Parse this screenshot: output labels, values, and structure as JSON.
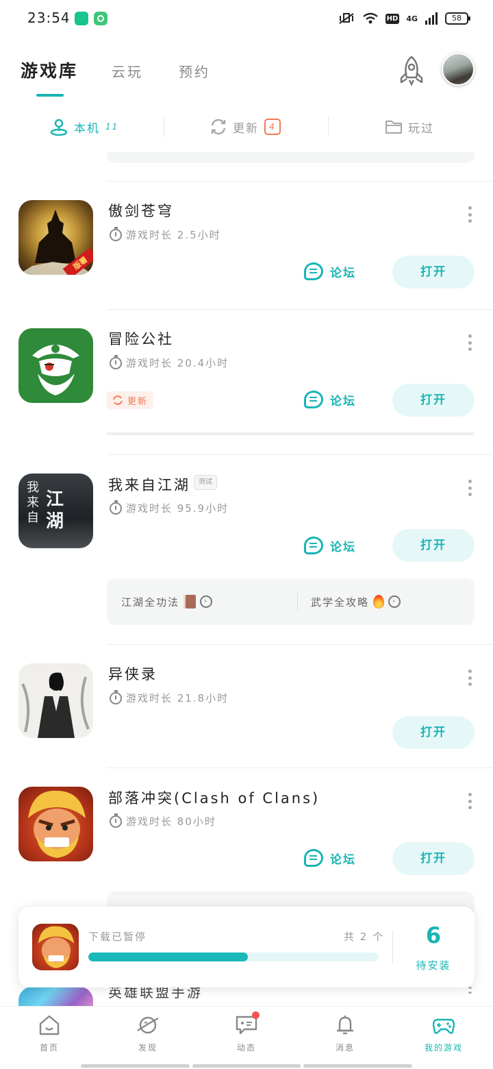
{
  "status_bar": {
    "time": "23:54",
    "network": "4G",
    "hd": "HD",
    "battery": "58"
  },
  "header": {
    "tabs": [
      {
        "label": "游戏库",
        "active": true
      },
      {
        "label": "云玩",
        "active": false
      },
      {
        "label": "预约",
        "active": false
      }
    ]
  },
  "subtabs": [
    {
      "label": "本机",
      "count": "11",
      "active": true
    },
    {
      "label": "更新",
      "badge": "4",
      "active": false
    },
    {
      "label": "玩过",
      "active": false
    }
  ],
  "games": [
    {
      "name": "傲剑苍穹",
      "playtime": "游戏时长 2.5小时",
      "forum": "论坛",
      "open": "打开",
      "icon_badge": "版署"
    },
    {
      "name": "冒险公社",
      "playtime": "游戏时长 20.4小时",
      "forum": "论坛",
      "open": "打开",
      "update_chip": "更新"
    },
    {
      "name": "我来自江湖",
      "tag": "测试",
      "playtime": "游戏时长 95.9小时",
      "forum": "论坛",
      "open": "打开",
      "icon_text": [
        "我来自",
        "江湖"
      ],
      "guides": [
        "江湖全功法",
        "武学全攻略"
      ]
    },
    {
      "name": "异侠录",
      "playtime": "游戏时长 21.8小时",
      "open": "打开"
    },
    {
      "name": "部落冲突(Clash of Clans)",
      "playtime": "游戏时长 80小时",
      "forum": "论坛",
      "open": "打开"
    },
    {
      "name": "英雄联盟手游"
    }
  ],
  "download": {
    "title": "下载已暂停",
    "count": "共 2 个",
    "progress": 0.55,
    "pending_num": "6",
    "pending_label": "待安装"
  },
  "bottom_nav": [
    {
      "label": "首页",
      "icon": "home-icon"
    },
    {
      "label": "发现",
      "icon": "planet-icon"
    },
    {
      "label": "动态",
      "icon": "chat-icon",
      "dot": true
    },
    {
      "label": "消息",
      "icon": "bell-icon"
    },
    {
      "label": "我的游戏",
      "icon": "gamepad-icon",
      "active": true
    }
  ],
  "colors": {
    "accent": "#18b4b4",
    "update": "#f07a52",
    "dot": "#f25454"
  }
}
